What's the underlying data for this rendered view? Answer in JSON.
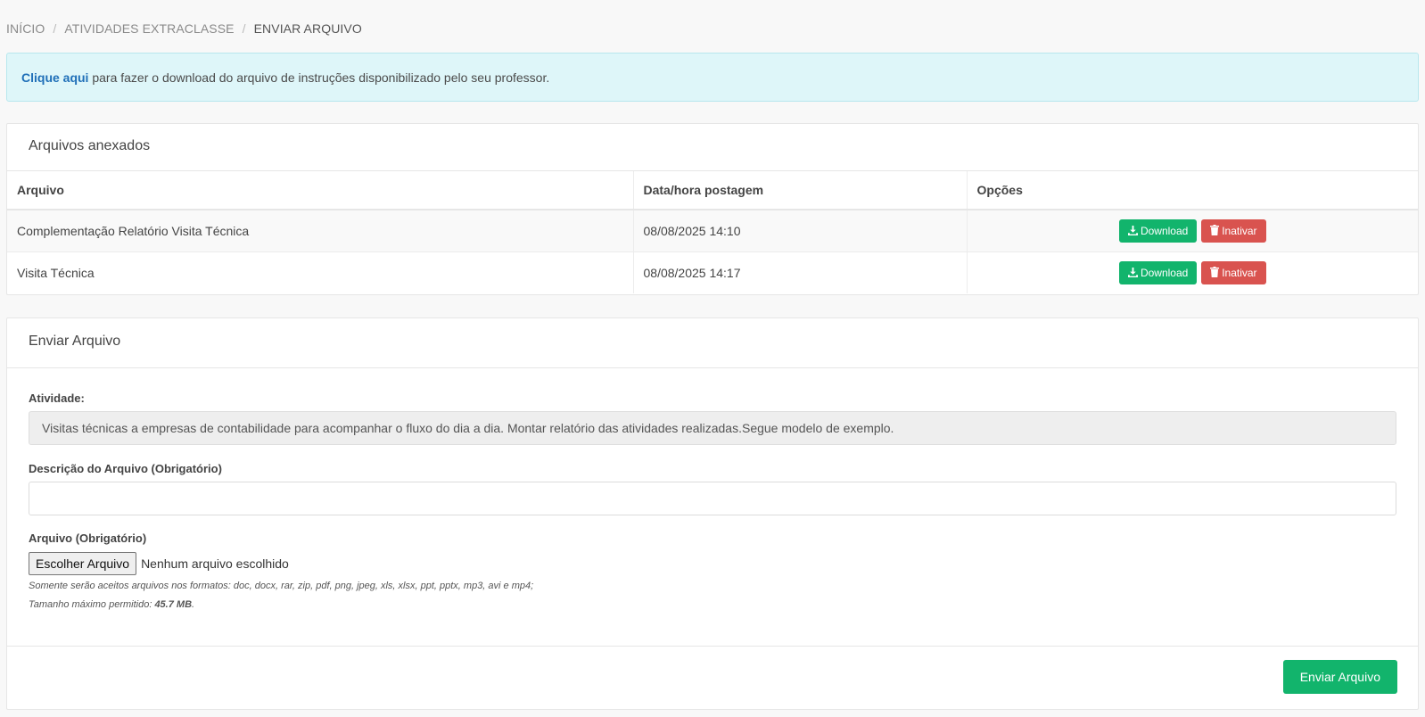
{
  "breadcrumb": {
    "items": [
      "INÍCIO",
      "ATIVIDADES EXTRACLASSE"
    ],
    "current": "ENVIAR ARQUIVO",
    "separator": "/"
  },
  "alert": {
    "link_text": "Clique aqui",
    "text": " para fazer o download do arquivo de instruções disponibilizado pelo seu professor."
  },
  "attachments": {
    "title": "Arquivos anexados",
    "columns": [
      "Arquivo",
      "Data/hora postagem",
      "Opções"
    ],
    "rows": [
      {
        "file": "Complementação Relatório Visita Técnica",
        "datetime": "08/08/2025 14:10",
        "download_label": "Download",
        "inactivate_label": "Inativar"
      },
      {
        "file": "Visita Técnica",
        "datetime": "08/08/2025 14:17",
        "download_label": "Download",
        "inactivate_label": "Inativar"
      }
    ]
  },
  "upload": {
    "title": "Enviar Arquivo",
    "activity_label": "Atividade:",
    "activity_text": "Visitas técnicas a empresas de contabilidade para acompanhar o fluxo do dia a dia. Montar relatório das atividades realizadas.Segue modelo de exemplo.",
    "description_label": "Descrição do Arquivo (Obrigatório)",
    "description_value": "",
    "file_label": "Arquivo (Obrigatório)",
    "file_button": "Escolher Arquivo",
    "file_status": "Nenhum arquivo escolhido",
    "hint_formats": "Somente serão aceitos arquivos nos formatos: doc, docx, rar, zip, pdf, png, jpeg, xls, xlsx, ppt, pptx, mp3, avi e mp4;",
    "hint_size_prefix": "Tamanho máximo permitido: ",
    "hint_size_value": "45.7 MB",
    "hint_size_suffix": ".",
    "submit_label": "Enviar Arquivo"
  },
  "colors": {
    "green": "#12b46c",
    "red": "#d9534f",
    "link": "#1f6fb8",
    "alert_bg": "#def6f9"
  },
  "icons": {
    "download": "download-icon",
    "trash": "trash-icon"
  }
}
